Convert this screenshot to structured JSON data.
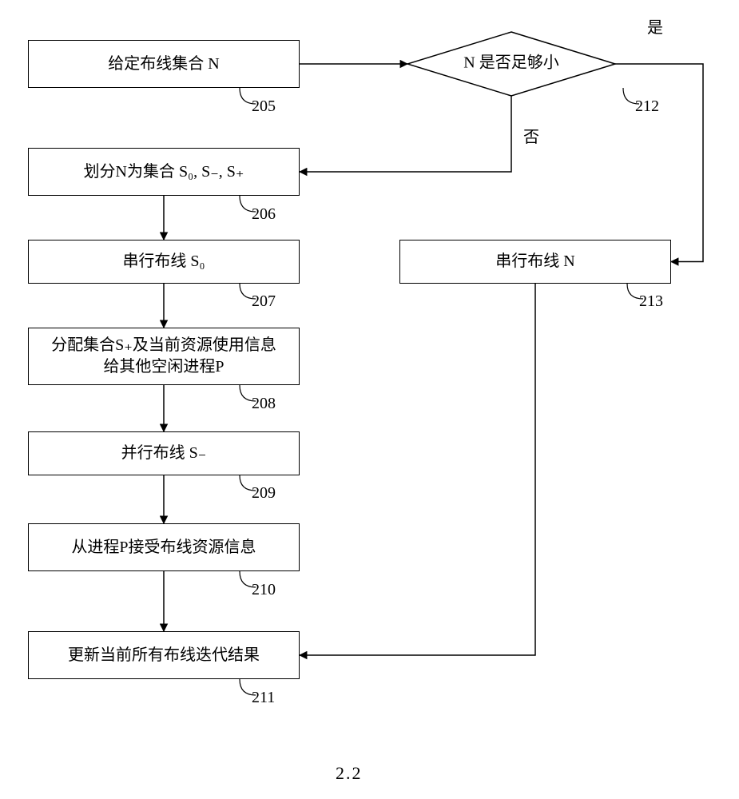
{
  "diagram": {
    "type": "flowchart",
    "nodes": {
      "n205": {
        "text": "给定布线集合 N",
        "ref": "205",
        "shape": "rect"
      },
      "n212": {
        "text": "N 是否足够小",
        "ref": "212",
        "shape": "diamond",
        "yes": "是",
        "no": "否"
      },
      "n206": {
        "text": "划分N为集合 S₀, S₋, S₊",
        "ref": "206",
        "shape": "rect"
      },
      "n207": {
        "text": "串行布线 S₀",
        "ref": "207",
        "shape": "rect"
      },
      "n208": {
        "text": "分配集合S₊及当前资源使用信息\n给其他空闲进程P",
        "ref": "208",
        "shape": "rect"
      },
      "n209": {
        "text": "并行布线 S₋",
        "ref": "209",
        "shape": "rect"
      },
      "n210": {
        "text": "从进程P接受布线资源信息",
        "ref": "210",
        "shape": "rect"
      },
      "n211": {
        "text": "更新当前所有布线迭代结果",
        "ref": "211",
        "shape": "rect"
      },
      "n213": {
        "text": "串行布线 N",
        "ref": "213",
        "shape": "rect"
      }
    },
    "edges": [
      {
        "from": "n205",
        "to": "n212"
      },
      {
        "from": "n212",
        "to": "n213",
        "label": "是"
      },
      {
        "from": "n212",
        "to": "n206",
        "label": "否"
      },
      {
        "from": "n206",
        "to": "n207"
      },
      {
        "from": "n207",
        "to": "n208"
      },
      {
        "from": "n208",
        "to": "n209"
      },
      {
        "from": "n209",
        "to": "n210"
      },
      {
        "from": "n210",
        "to": "n211"
      },
      {
        "from": "n213",
        "to": "n211"
      }
    ],
    "figure_label": "2.2"
  }
}
